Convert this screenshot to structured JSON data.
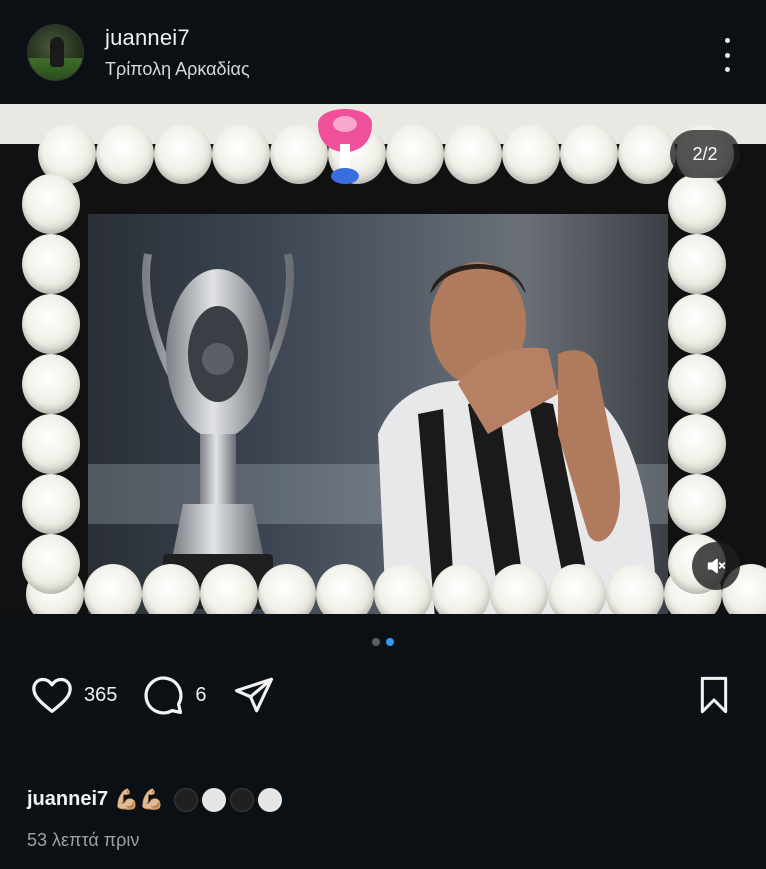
{
  "post": {
    "username": "juannei7",
    "location": "Τρίπολη Αρκαδίας",
    "slide_counter": "2/2",
    "slides_total": 2,
    "active_slide": 2
  },
  "actions": {
    "likes": "365",
    "comments": "6"
  },
  "caption": {
    "username": "juannei7",
    "emoji_arms": "💪🏼💪🏼",
    "balls": [
      "black",
      "white",
      "black",
      "white"
    ]
  },
  "timestamp": "53 λεπτά πριν",
  "colors": {
    "background": "#0b1014",
    "pager_active": "#3897f0",
    "pager_inactive": "#5a5f66"
  },
  "icons": {
    "more": "more-vertical-icon",
    "heart": "heart-icon",
    "comment": "comment-icon",
    "share": "send-icon",
    "save": "bookmark-icon",
    "mute": "muted-speaker-icon"
  }
}
